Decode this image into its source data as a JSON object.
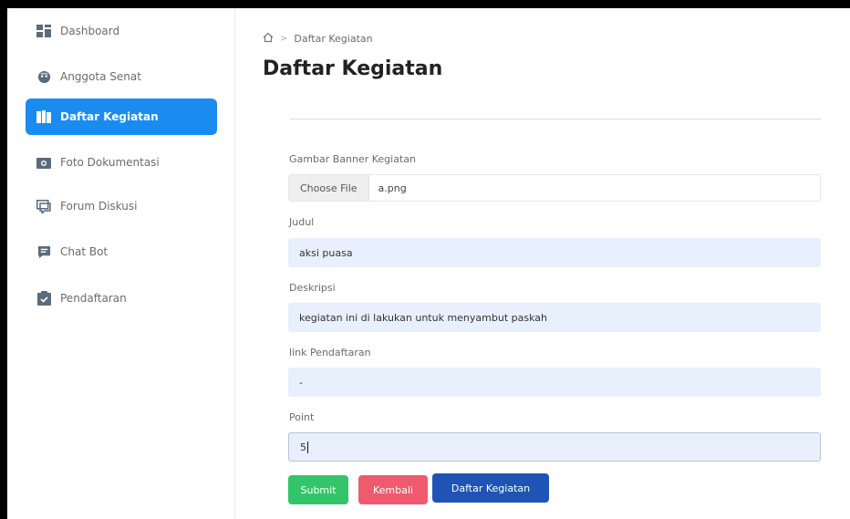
{
  "sidebar": {
    "items": [
      {
        "label": "Dashboard",
        "icon": "dashboard-icon",
        "active": false
      },
      {
        "label": "Anggota Senat",
        "icon": "user-face-icon",
        "active": false
      },
      {
        "label": "Daftar Kegiatan",
        "icon": "book-icon",
        "active": true
      },
      {
        "label": "Foto Dokumentasi",
        "icon": "camera-icon",
        "active": false
      },
      {
        "label": "Forum Diskusi",
        "icon": "chat-icon",
        "active": false
      },
      {
        "label": "Chat Bot",
        "icon": "message-bot-icon",
        "active": false
      },
      {
        "label": "Pendaftaran",
        "icon": "clipboard-icon",
        "active": false
      }
    ]
  },
  "breadcrumb": {
    "home_icon": "home-icon",
    "current": "Daftar Kegiatan"
  },
  "page": {
    "title": "Daftar Kegiatan"
  },
  "form": {
    "banner_label": "Gambar Banner Kegiatan",
    "file_button": "Choose File",
    "file_name": "a.png",
    "judul_label": "Judul",
    "judul_value": "aksi puasa",
    "deskripsi_label": "Deskripsi",
    "deskripsi_value": "kegiatan ini di lakukan untuk menyambut paskah",
    "link_label": "link Pendaftaran",
    "link_value": "-",
    "point_label": "Point",
    "point_value": "5"
  },
  "buttons": {
    "submit": "Submit",
    "back": "Kembali",
    "list": "Daftar Kegiatan"
  },
  "colors": {
    "accent": "#1a8cf0",
    "submit": "#34c46a",
    "back": "#f05a6e",
    "list": "#2054b4"
  }
}
